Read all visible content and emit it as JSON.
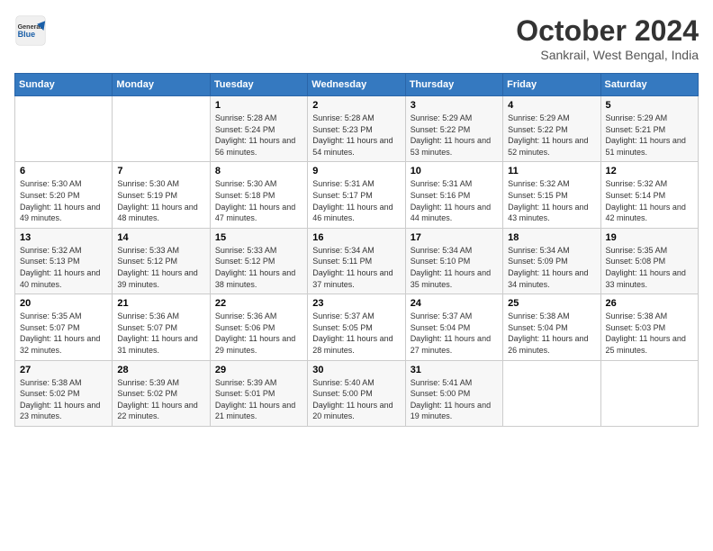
{
  "logo": {
    "general": "General",
    "blue": "Blue"
  },
  "header": {
    "month": "October 2024",
    "location": "Sankrail, West Bengal, India"
  },
  "weekdays": [
    "Sunday",
    "Monday",
    "Tuesday",
    "Wednesday",
    "Thursday",
    "Friday",
    "Saturday"
  ],
  "weeks": [
    [
      {
        "day": "",
        "sunrise": "",
        "sunset": "",
        "daylight": ""
      },
      {
        "day": "",
        "sunrise": "",
        "sunset": "",
        "daylight": ""
      },
      {
        "day": "1",
        "sunrise": "Sunrise: 5:28 AM",
        "sunset": "Sunset: 5:24 PM",
        "daylight": "Daylight: 11 hours and 56 minutes."
      },
      {
        "day": "2",
        "sunrise": "Sunrise: 5:28 AM",
        "sunset": "Sunset: 5:23 PM",
        "daylight": "Daylight: 11 hours and 54 minutes."
      },
      {
        "day": "3",
        "sunrise": "Sunrise: 5:29 AM",
        "sunset": "Sunset: 5:22 PM",
        "daylight": "Daylight: 11 hours and 53 minutes."
      },
      {
        "day": "4",
        "sunrise": "Sunrise: 5:29 AM",
        "sunset": "Sunset: 5:22 PM",
        "daylight": "Daylight: 11 hours and 52 minutes."
      },
      {
        "day": "5",
        "sunrise": "Sunrise: 5:29 AM",
        "sunset": "Sunset: 5:21 PM",
        "daylight": "Daylight: 11 hours and 51 minutes."
      }
    ],
    [
      {
        "day": "6",
        "sunrise": "Sunrise: 5:30 AM",
        "sunset": "Sunset: 5:20 PM",
        "daylight": "Daylight: 11 hours and 49 minutes."
      },
      {
        "day": "7",
        "sunrise": "Sunrise: 5:30 AM",
        "sunset": "Sunset: 5:19 PM",
        "daylight": "Daylight: 11 hours and 48 minutes."
      },
      {
        "day": "8",
        "sunrise": "Sunrise: 5:30 AM",
        "sunset": "Sunset: 5:18 PM",
        "daylight": "Daylight: 11 hours and 47 minutes."
      },
      {
        "day": "9",
        "sunrise": "Sunrise: 5:31 AM",
        "sunset": "Sunset: 5:17 PM",
        "daylight": "Daylight: 11 hours and 46 minutes."
      },
      {
        "day": "10",
        "sunrise": "Sunrise: 5:31 AM",
        "sunset": "Sunset: 5:16 PM",
        "daylight": "Daylight: 11 hours and 44 minutes."
      },
      {
        "day": "11",
        "sunrise": "Sunrise: 5:32 AM",
        "sunset": "Sunset: 5:15 PM",
        "daylight": "Daylight: 11 hours and 43 minutes."
      },
      {
        "day": "12",
        "sunrise": "Sunrise: 5:32 AM",
        "sunset": "Sunset: 5:14 PM",
        "daylight": "Daylight: 11 hours and 42 minutes."
      }
    ],
    [
      {
        "day": "13",
        "sunrise": "Sunrise: 5:32 AM",
        "sunset": "Sunset: 5:13 PM",
        "daylight": "Daylight: 11 hours and 40 minutes."
      },
      {
        "day": "14",
        "sunrise": "Sunrise: 5:33 AM",
        "sunset": "Sunset: 5:12 PM",
        "daylight": "Daylight: 11 hours and 39 minutes."
      },
      {
        "day": "15",
        "sunrise": "Sunrise: 5:33 AM",
        "sunset": "Sunset: 5:12 PM",
        "daylight": "Daylight: 11 hours and 38 minutes."
      },
      {
        "day": "16",
        "sunrise": "Sunrise: 5:34 AM",
        "sunset": "Sunset: 5:11 PM",
        "daylight": "Daylight: 11 hours and 37 minutes."
      },
      {
        "day": "17",
        "sunrise": "Sunrise: 5:34 AM",
        "sunset": "Sunset: 5:10 PM",
        "daylight": "Daylight: 11 hours and 35 minutes."
      },
      {
        "day": "18",
        "sunrise": "Sunrise: 5:34 AM",
        "sunset": "Sunset: 5:09 PM",
        "daylight": "Daylight: 11 hours and 34 minutes."
      },
      {
        "day": "19",
        "sunrise": "Sunrise: 5:35 AM",
        "sunset": "Sunset: 5:08 PM",
        "daylight": "Daylight: 11 hours and 33 minutes."
      }
    ],
    [
      {
        "day": "20",
        "sunrise": "Sunrise: 5:35 AM",
        "sunset": "Sunset: 5:07 PM",
        "daylight": "Daylight: 11 hours and 32 minutes."
      },
      {
        "day": "21",
        "sunrise": "Sunrise: 5:36 AM",
        "sunset": "Sunset: 5:07 PM",
        "daylight": "Daylight: 11 hours and 31 minutes."
      },
      {
        "day": "22",
        "sunrise": "Sunrise: 5:36 AM",
        "sunset": "Sunset: 5:06 PM",
        "daylight": "Daylight: 11 hours and 29 minutes."
      },
      {
        "day": "23",
        "sunrise": "Sunrise: 5:37 AM",
        "sunset": "Sunset: 5:05 PM",
        "daylight": "Daylight: 11 hours and 28 minutes."
      },
      {
        "day": "24",
        "sunrise": "Sunrise: 5:37 AM",
        "sunset": "Sunset: 5:04 PM",
        "daylight": "Daylight: 11 hours and 27 minutes."
      },
      {
        "day": "25",
        "sunrise": "Sunrise: 5:38 AM",
        "sunset": "Sunset: 5:04 PM",
        "daylight": "Daylight: 11 hours and 26 minutes."
      },
      {
        "day": "26",
        "sunrise": "Sunrise: 5:38 AM",
        "sunset": "Sunset: 5:03 PM",
        "daylight": "Daylight: 11 hours and 25 minutes."
      }
    ],
    [
      {
        "day": "27",
        "sunrise": "Sunrise: 5:38 AM",
        "sunset": "Sunset: 5:02 PM",
        "daylight": "Daylight: 11 hours and 23 minutes."
      },
      {
        "day": "28",
        "sunrise": "Sunrise: 5:39 AM",
        "sunset": "Sunset: 5:02 PM",
        "daylight": "Daylight: 11 hours and 22 minutes."
      },
      {
        "day": "29",
        "sunrise": "Sunrise: 5:39 AM",
        "sunset": "Sunset: 5:01 PM",
        "daylight": "Daylight: 11 hours and 21 minutes."
      },
      {
        "day": "30",
        "sunrise": "Sunrise: 5:40 AM",
        "sunset": "Sunset: 5:00 PM",
        "daylight": "Daylight: 11 hours and 20 minutes."
      },
      {
        "day": "31",
        "sunrise": "Sunrise: 5:41 AM",
        "sunset": "Sunset: 5:00 PM",
        "daylight": "Daylight: 11 hours and 19 minutes."
      },
      {
        "day": "",
        "sunrise": "",
        "sunset": "",
        "daylight": ""
      },
      {
        "day": "",
        "sunrise": "",
        "sunset": "",
        "daylight": ""
      }
    ]
  ]
}
